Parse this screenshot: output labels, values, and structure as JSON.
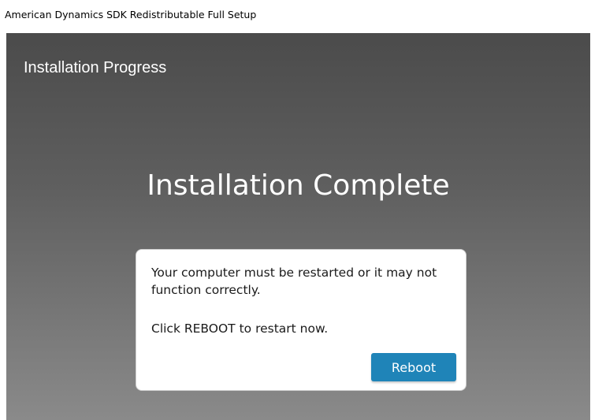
{
  "window": {
    "title": "American Dynamics SDK Redistributable Full Setup"
  },
  "content": {
    "section_heading": "Installation Progress",
    "main_heading": "Installation Complete"
  },
  "dialog": {
    "message": "Your computer must be restarted or it may not function correctly.",
    "instruction": "Click REBOOT to restart now.",
    "reboot_label": "Reboot"
  },
  "colors": {
    "accent": "#1f84b8",
    "background_top": "#4b4b4b",
    "background_bottom": "#8a8a8a"
  }
}
